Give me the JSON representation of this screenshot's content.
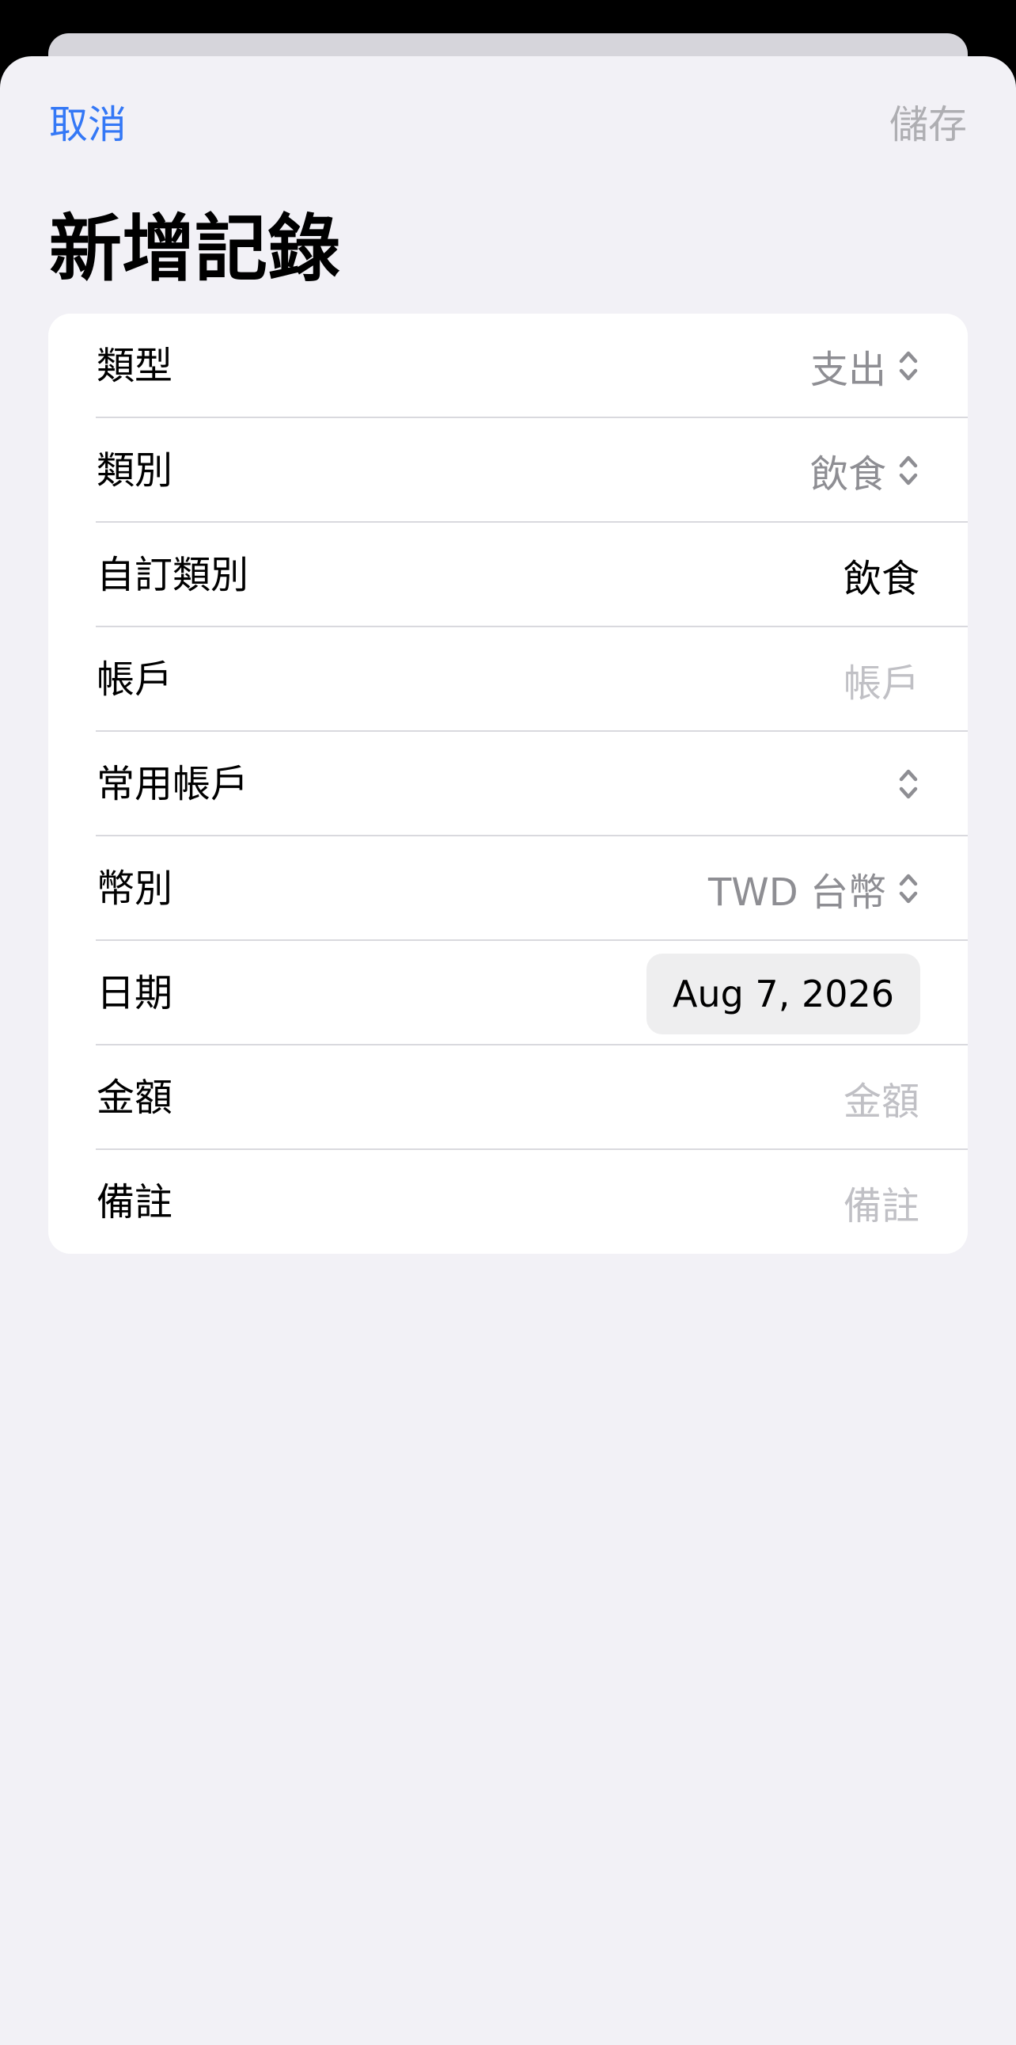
{
  "nav": {
    "cancel_label": "取消",
    "save_label": "儲存"
  },
  "title": "新增記錄",
  "form": {
    "rows": [
      {
        "label": "類型",
        "value": "支出"
      },
      {
        "label": "類別",
        "value": "飲食"
      },
      {
        "label": "自訂類別",
        "value": "飲食"
      },
      {
        "label": "帳戶",
        "placeholder": "帳戶"
      },
      {
        "label": "常用帳戶",
        "value": ""
      },
      {
        "label": "幣別",
        "value": "TWD 台幣"
      },
      {
        "label": "日期",
        "value": "Aug 7, 2026"
      },
      {
        "label": "金額",
        "placeholder": "金額"
      },
      {
        "label": "備註",
        "placeholder": "備註"
      }
    ]
  },
  "icons": {
    "picker_chevrons": "chevron-up-down-icon"
  },
  "colors": {
    "accent": "#3478f6",
    "disabled": "#aeaeb2",
    "background": "#f2f1f6"
  }
}
